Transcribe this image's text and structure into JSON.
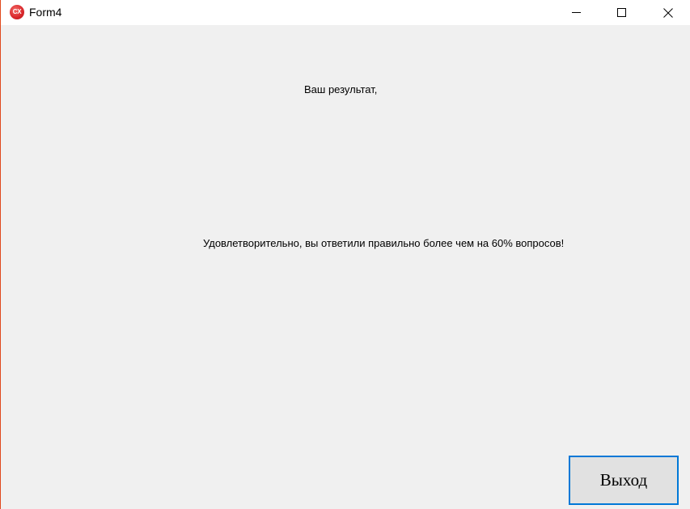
{
  "window": {
    "title": "Form4",
    "icon": "cx-app-icon",
    "icon_text": "CX",
    "accent_color": "#e0491d",
    "controls": {
      "minimize": "minimize-icon",
      "maximize": "maximize-icon",
      "close": "close-icon"
    }
  },
  "content": {
    "result_label": "Ваш результат,",
    "message": "Удовлетворительно, вы ответили правильно более чем на 60% вопросов!",
    "exit_button": "Выход"
  },
  "colors": {
    "client_background": "#f0f0f0",
    "button_background": "#e1e1e1",
    "button_focus_border": "#0078d7"
  }
}
